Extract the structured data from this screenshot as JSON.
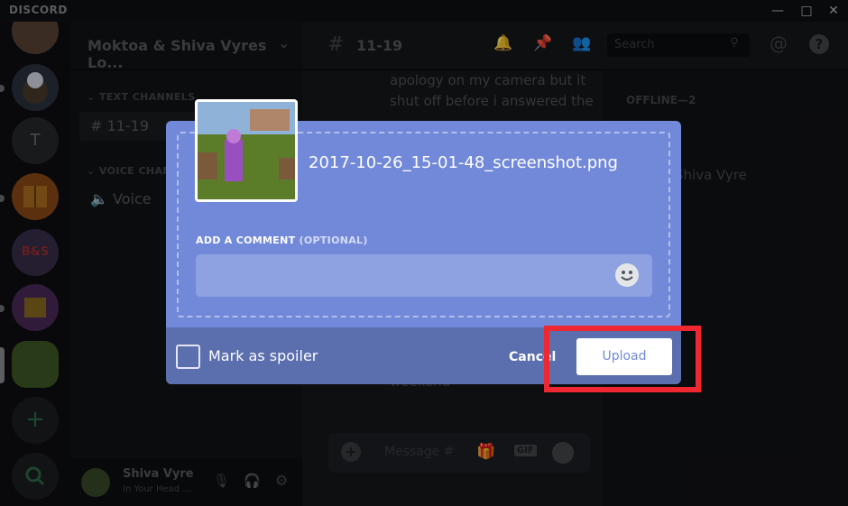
{
  "titlebar": {
    "brand": "DISCORD"
  },
  "guild": {
    "name": "Moktoa & Shiva Vyres Lo..."
  },
  "sidebar": {
    "text_category": "TEXT CHANNELS",
    "voice_category": "VOICE CHANNE",
    "channels": [
      {
        "name": "11-19"
      },
      {
        "name": "Voice"
      }
    ],
    "server_initial": "T",
    "server_badge": "B&S"
  },
  "user": {
    "name": "Shiva Vyre",
    "status": "In Your Head ..."
  },
  "chat": {
    "channel": "11-19",
    "search_placeholder": "Search",
    "message_lines": [
      "apology on my camera but it",
      "shut off before i answered the"
    ],
    "message_tail": "weekend",
    "composer_placeholder": "Message #"
  },
  "members": {
    "offline_header": "OFFLINE—2",
    "member_name": "Shiva Vyre"
  },
  "modal": {
    "filename": "2017-10-26_15-01-48_screenshot.png",
    "comment_label": "ADD A COMMENT",
    "comment_optional": "(OPTIONAL)",
    "comment_value": "",
    "spoiler_label": "Mark as spoiler",
    "cancel_label": "Cancel",
    "upload_label": "Upload"
  },
  "colors": {
    "blurple": "#7289da",
    "footer": "#5b6eae",
    "highlight": "#ef2731"
  }
}
